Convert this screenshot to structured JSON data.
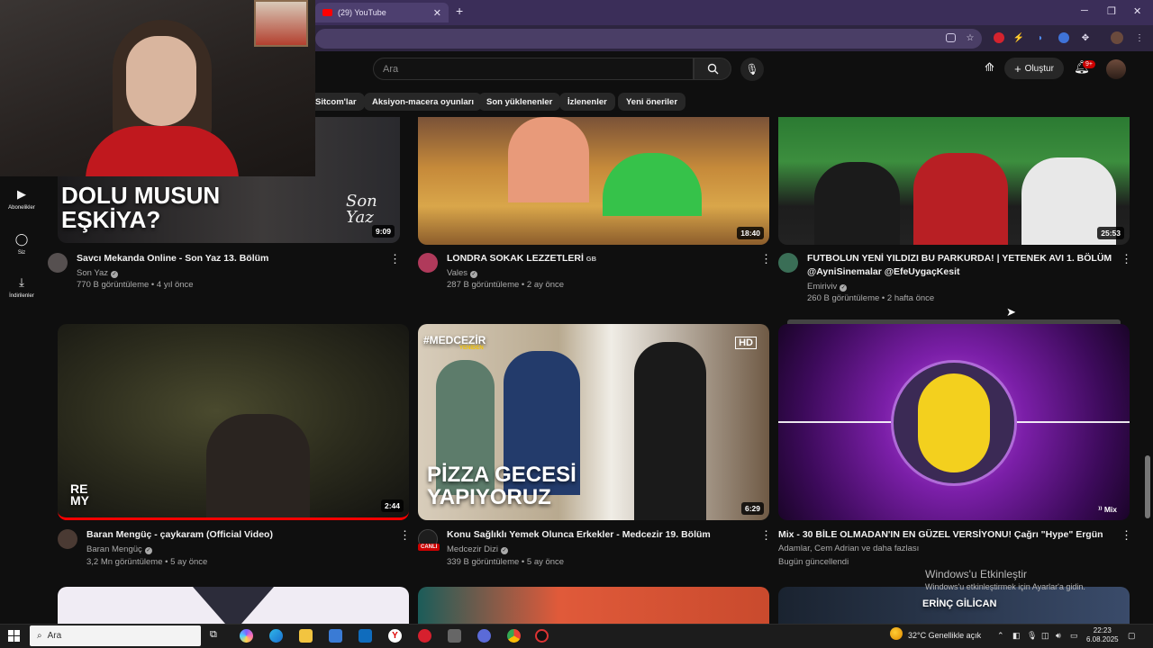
{
  "browser": {
    "tab_title": "(29) YouTube",
    "tab_close": "✕",
    "new_tab": "+",
    "window_controls": [
      "─",
      "❐",
      "✕"
    ]
  },
  "header": {
    "search_placeholder": "Ara",
    "create_label": "Oluştur",
    "notification_count": "9+"
  },
  "chips": [
    "Sitcom'lar",
    "Aksiyon-macera oyunları",
    "Son yüklenenler",
    "İzlenenler",
    "Yeni öneriler"
  ],
  "sidebar": [
    {
      "label": "Abonelikler",
      "icon": "subscriptions-icon",
      "glyph": "▶"
    },
    {
      "label": "Siz",
      "icon": "you-icon",
      "glyph": "◯"
    },
    {
      "label": "İndirilenler",
      "icon": "downloads-icon",
      "glyph": "⤓"
    }
  ],
  "videos": [
    {
      "title": "Savcı Mekanda Online - Son Yaz 13. Bölüm",
      "channel": "Son Yaz",
      "views": "770 B görüntüleme",
      "age": "4 yıl önce",
      "duration": "9:09",
      "overlay": "DOLU MUSUN EŞKİYA?",
      "overlay2": "Son Yaz"
    },
    {
      "title": "LONDRA SOKAK LEZZETLERİ",
      "title_badge": "GB",
      "channel": "Vales",
      "views": "287 B görüntüleme",
      "age": "2 ay önce",
      "duration": "18:40"
    },
    {
      "title": "FUTBOLUN YENİ YILDIZI BU PARKURDA! | YETENEK AVI 1. BÖLÜM @AyniSinemalar @EfeUygaçKesit",
      "channel": "Emiriviv",
      "views": "260 B görüntüleme",
      "age": "2 hafta önce",
      "duration": "25:53"
    },
    {
      "title": "Baran Mengüç - çaykaram (Official Video)",
      "channel": "Baran Mengüç",
      "views": "3,2 Mn görüntüleme",
      "age": "5 ay önce",
      "duration": "2:44",
      "overlay": "RE MY"
    },
    {
      "title": "Konu Sağlıklı Yemek Olunca Erkekler - Medcezir 19. Bölüm",
      "channel": "Medcezir Dizi",
      "views": "339 B görüntüleme",
      "age": "5 ay önce",
      "duration": "6:29",
      "overlay": "PİZZA GECESİ YAPIYORUZ",
      "overlay2": "#MEDCEZİR",
      "overlay3": "YENİDEN",
      "hd": "HD",
      "live_badge": "CANLI"
    },
    {
      "title": "Mix - 30 BİLE OLMADAN'IN EN GÜZEL VERSİYONU! Çağrı \"Hype\" Ergün",
      "channel": "Adamlar, Cem Adrian ve daha fazlası",
      "views": "Bugün güncellendi",
      "age": "",
      "duration": "Mix"
    }
  ],
  "bottom_overlay": "ERİNÇ GİLİCAN",
  "watermark": {
    "line1": "Windows'u Etkinleştir",
    "line2": "Windows'u etkinleştirmek için Ayarlar'a gidin."
  },
  "taskbar": {
    "search_placeholder": "Ara",
    "weather": "32°C  Genellikle açık",
    "time": "22:23",
    "date": "6.08.2025"
  }
}
